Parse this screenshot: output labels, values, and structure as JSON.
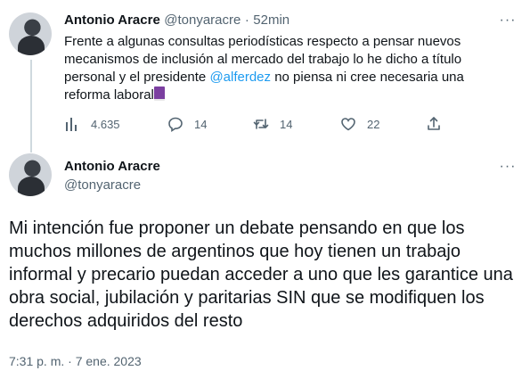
{
  "tweet1": {
    "author_name": "Antonio Aracre",
    "handle": "@tonyaracre",
    "separator": "·",
    "time": "52min",
    "text_before": "Frente a algunas consultas periodísticas respecto a pensar nuevos mecanismos de inclusión al mercado del trabajo lo he dicho a título personal y el presidente",
    "mention": "@alferdez",
    "text_after": "no piensa ni cree necesaria una reforma laboral",
    "emoji_icon": "book-icon",
    "views": "4.635",
    "replies": "14",
    "retweets": "14",
    "likes": "22"
  },
  "tweet2": {
    "author_name": "Antonio Aracre",
    "handle": "@tonyaracre",
    "text": "Mi intención fue proponer un debate pensando en que los muchos millones de argentinos que hoy tienen un trabajo informal y precario puedan acceder a uno que les garantice una obra social, jubilación y paritarias SIN que se modifiquen los derechos adquiridos del resto",
    "timestamp": "7:31 p. m. · 7 ene. 2023"
  },
  "icons": [
    "more-icon",
    "views-icon",
    "reply-icon",
    "retweet-icon",
    "like-icon",
    "share-icon"
  ],
  "colors": {
    "link": "#1d9bf0",
    "muted": "#536471",
    "text": "#0f1419",
    "thread_line": "#cfd9de"
  }
}
